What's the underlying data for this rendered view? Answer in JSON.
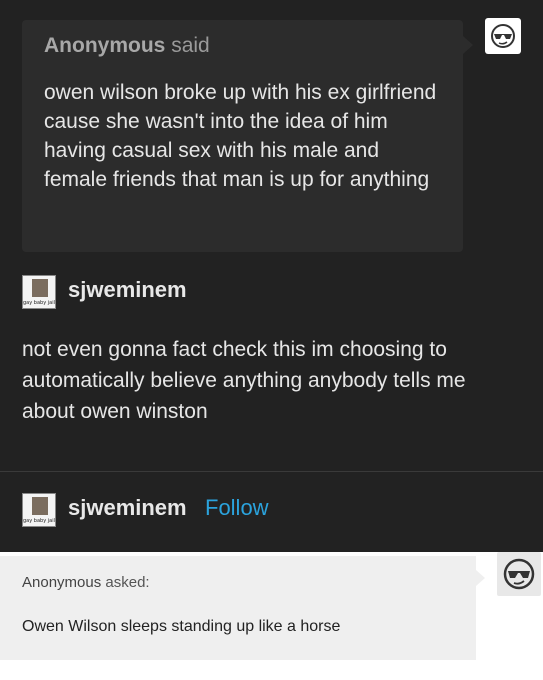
{
  "ask": {
    "asker": "Anonymous",
    "verb": "said",
    "text": "owen wilson broke up with his ex girlfriend cause she wasn't into the idea of him having casual sex with his male and female friends that man is up for anything",
    "avatar_icon": "anonymous-sunglasses-icon"
  },
  "reply": {
    "username": "sjweminem",
    "avatar_caption": "gay baby jail",
    "text": "not even gonna fact check this im choosing to automatically believe anything anybody tells me about owen winston"
  },
  "post": {
    "username": "sjweminem",
    "avatar_caption": "gay baby jail",
    "follow_label": "Follow"
  },
  "ask2": {
    "asker": "Anonymous",
    "verb": "asked:",
    "text": "Owen Wilson sleeps standing up like a horse",
    "avatar_icon": "anonymous-sunglasses-icon"
  },
  "colors": {
    "background": "#222222",
    "follow": "#2ba3dd",
    "white_panel": "#ffffff"
  }
}
